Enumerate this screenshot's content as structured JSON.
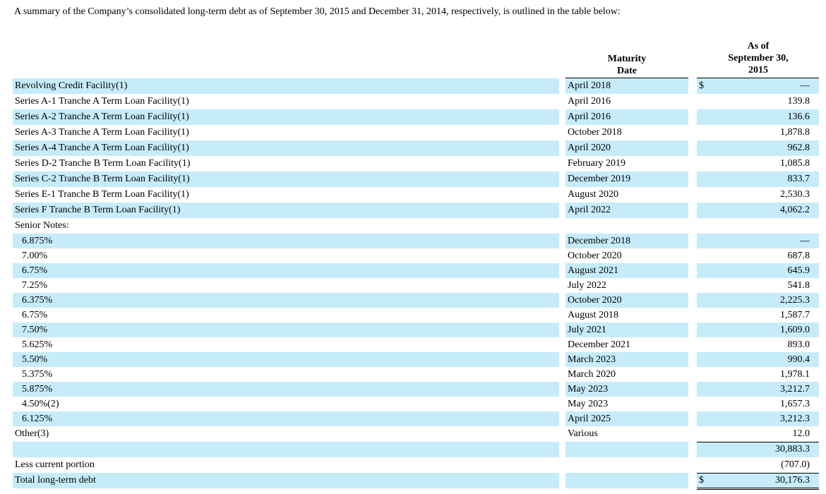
{
  "intro_text": "A summary of the Company’s consolidated long-term debt as of September 30, 2015 and December 31, 2014, respectively, is outlined in the table below:",
  "headers": {
    "maturity_line1": "Maturity",
    "maturity_line2": "Date",
    "asof_line1": "As of",
    "asof_line2": "September 30,",
    "asof_line3": "2015"
  },
  "currency_symbol": "$",
  "rows": [
    {
      "label": "Revolving Credit Facility(1)",
      "date": "April 2018",
      "amount": "—",
      "dollar": true
    },
    {
      "label": "Series A-1 Tranche A Term Loan Facility(1)",
      "date": "April 2016",
      "amount": "139.8"
    },
    {
      "label": "Series A-2 Tranche A Term Loan Facility(1)",
      "date": "April 2016",
      "amount": "136.6"
    },
    {
      "label": "Series A-3 Tranche A Term Loan Facility(1)",
      "date": "October 2018",
      "amount": "1,878.8"
    },
    {
      "label": "Series A-4 Tranche A Term Loan Facility(1)",
      "date": "April 2020",
      "amount": "962.8"
    },
    {
      "label": "Series D-2 Tranche B Term Loan Facility(1)",
      "date": "February 2019",
      "amount": "1,085.8"
    },
    {
      "label": "Series C-2 Tranche B Term Loan Facility(1)",
      "date": "December 2019",
      "amount": "833.7"
    },
    {
      "label": "Series E-1 Tranche B Term Loan Facility(1)",
      "date": "August 2020",
      "amount": "2,530.3"
    },
    {
      "label": "Series F Tranche B Term Loan Facility(1)",
      "date": "April 2022",
      "amount": "4,062.2"
    },
    {
      "label": "Senior Notes:",
      "date": "",
      "amount": ""
    },
    {
      "label": "6.875%",
      "date": "December 2018",
      "amount": "—",
      "indent": true
    },
    {
      "label": "7.00%",
      "date": "October 2020",
      "amount": "687.8",
      "indent": true
    },
    {
      "label": "6.75%",
      "date": "August 2021",
      "amount": "645.9",
      "indent": true
    },
    {
      "label": "7.25%",
      "date": "July 2022",
      "amount": "541.8",
      "indent": true
    },
    {
      "label": "6.375%",
      "date": "October 2020",
      "amount": "2,225.3",
      "indent": true
    },
    {
      "label": "6.75%",
      "date": "August 2018",
      "amount": "1,587.7",
      "indent": true
    },
    {
      "label": "7.50%",
      "date": "July 2021",
      "amount": "1,609.0",
      "indent": true
    },
    {
      "label": "5.625%",
      "date": "December 2021",
      "amount": "893.0",
      "indent": true
    },
    {
      "label": "5.50%",
      "date": "March 2023",
      "amount": "990.4",
      "indent": true
    },
    {
      "label": "5.375%",
      "date": "March 2020",
      "amount": "1,978.1",
      "indent": true
    },
    {
      "label": "5.875%",
      "date": "May 2023",
      "amount": "3,212.7",
      "indent": true
    },
    {
      "label": "4.50%(2)",
      "date": "May 2023",
      "amount": "1,657.3",
      "indent": true
    },
    {
      "label": "6.125%",
      "date": "April 2025",
      "amount": "3,212.3",
      "indent": true
    },
    {
      "label": "Other(3)",
      "date": "Various",
      "amount": "12.0"
    },
    {
      "label": "",
      "date": "",
      "amount": "30,883.3"
    },
    {
      "label": "Less current portion",
      "date": "",
      "amount": "(707.0)"
    },
    {
      "label": "Total long-term debt",
      "date": "",
      "amount": "30,176.3",
      "dollar": true
    }
  ]
}
